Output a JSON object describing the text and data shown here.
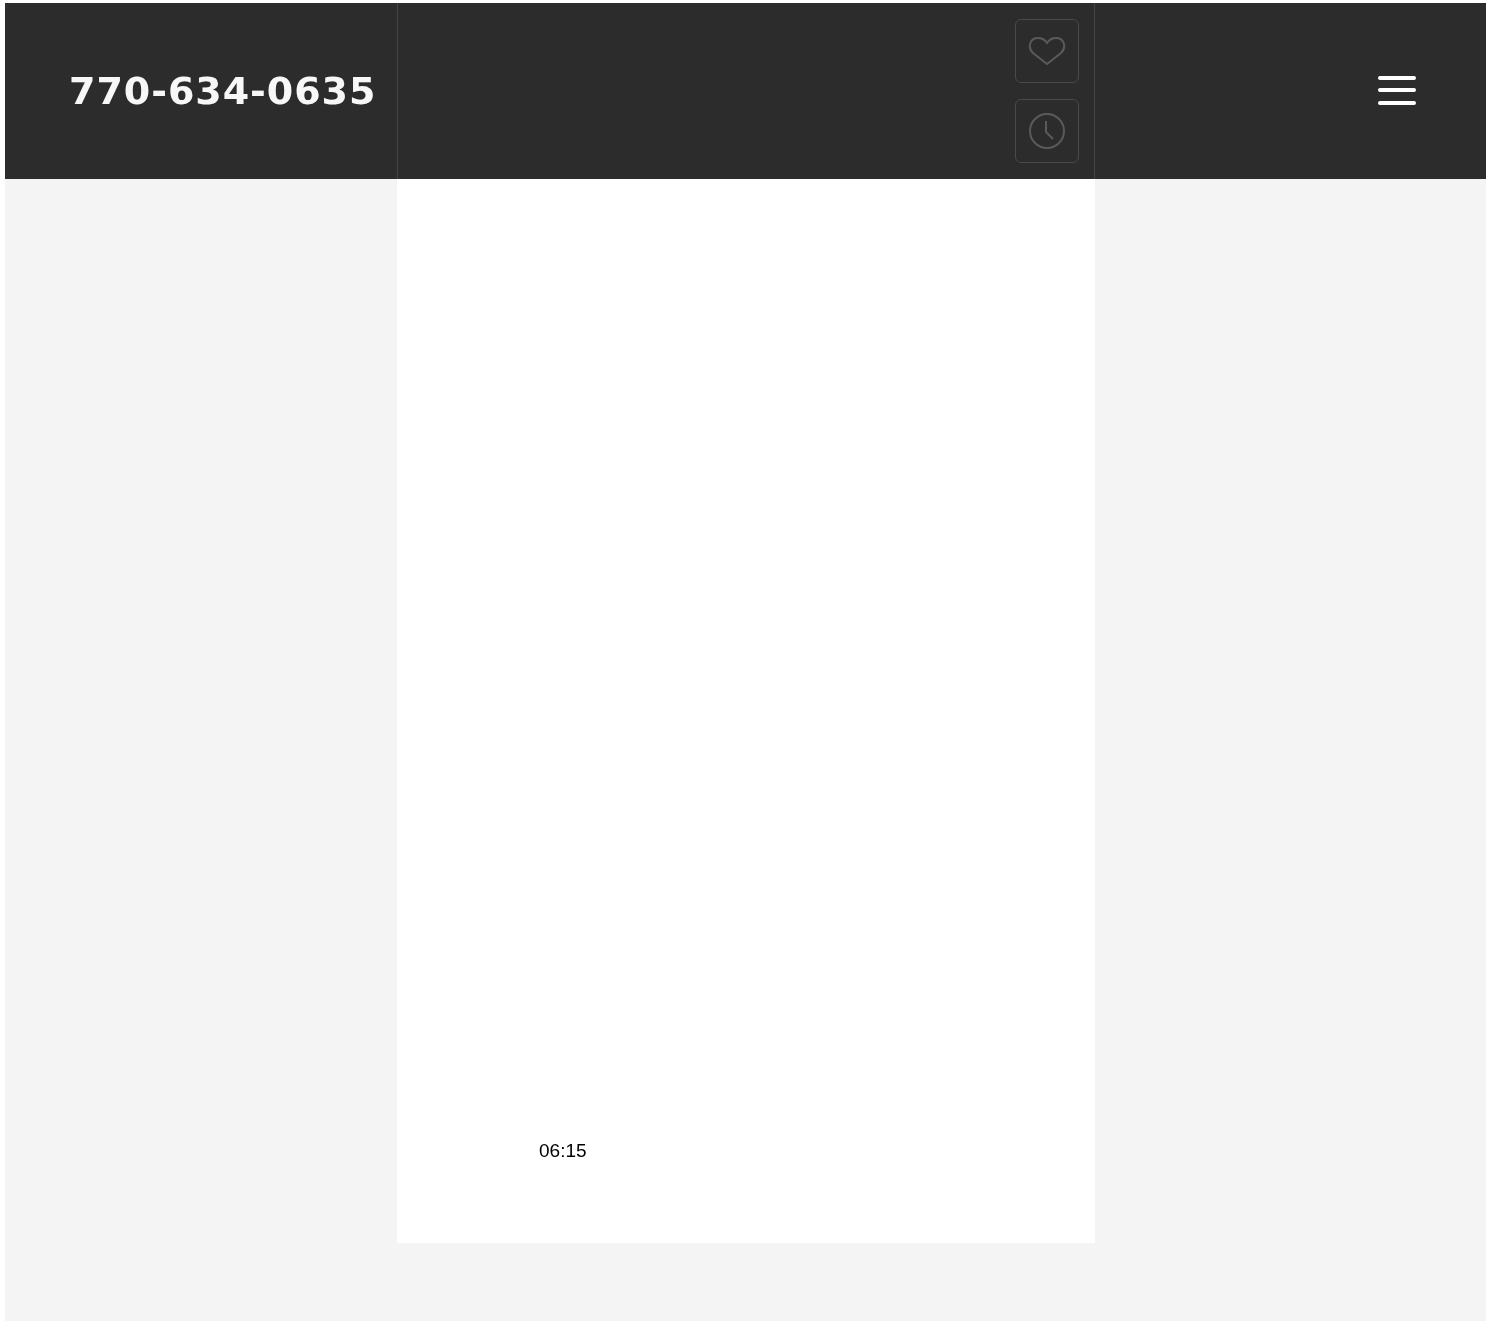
{
  "header": {
    "phone": "770-634-0635"
  },
  "content": {
    "time": "06:15"
  }
}
